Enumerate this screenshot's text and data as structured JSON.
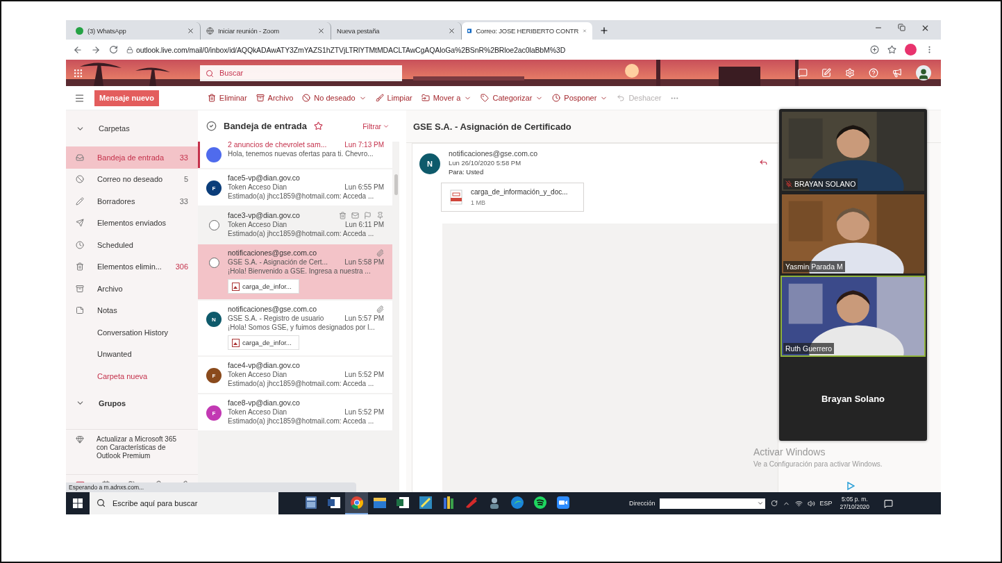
{
  "browser": {
    "tabs": [
      {
        "title": "(3) WhatsApp",
        "selected": false
      },
      {
        "title": "Iniciar reunión - Zoom",
        "selected": false
      },
      {
        "title": "Nueva pestaña",
        "selected": false
      },
      {
        "title": "Correo: JOSE HERIBERTO CONTR",
        "selected": true
      }
    ],
    "url": "outlook.live.com/mail/0/inbox/id/AQQkADAwATY3ZmYAZS1hZTVjLTRlYTMtMDACLTAwCgAQAloGa%2BSnR%2BRloe2ac0laBbM%3D"
  },
  "outlook": {
    "search_placeholder": "Buscar",
    "new_message": "Mensaje nuevo",
    "commands": [
      {
        "label": "Eliminar",
        "menu": false,
        "disabled": false
      },
      {
        "label": "Archivo",
        "menu": false,
        "disabled": false
      },
      {
        "label": "No deseado",
        "menu": true,
        "disabled": false
      },
      {
        "label": "Limpiar",
        "menu": false,
        "disabled": false
      },
      {
        "label": "Mover a",
        "menu": true,
        "disabled": false
      },
      {
        "label": "Categorizar",
        "menu": true,
        "disabled": false
      },
      {
        "label": "Posponer",
        "menu": true,
        "disabled": false
      },
      {
        "label": "Deshacer",
        "menu": false,
        "disabled": true
      }
    ],
    "folders": {
      "title": "Carpetas",
      "expanded": true,
      "items": [
        {
          "kind": "folder",
          "label": "Bandeja de entrada",
          "count": "33",
          "count_highlight": true,
          "selected": true
        },
        {
          "kind": "folder",
          "label": "Correo no deseado",
          "count": "5",
          "count_highlight": false,
          "selected": false
        },
        {
          "kind": "folder",
          "label": "Borradores",
          "count": "33",
          "count_highlight": false,
          "selected": false
        },
        {
          "kind": "folder",
          "label": "Elementos enviados",
          "selected": false
        },
        {
          "kind": "folder",
          "label": "Scheduled",
          "selected": false
        },
        {
          "kind": "folder",
          "label": "Elementos elimin...",
          "count": "306",
          "count_highlight": true,
          "selected": false
        },
        {
          "kind": "folder",
          "label": "Archivo",
          "selected": false
        },
        {
          "kind": "folder",
          "label": "Notas",
          "selected": false
        },
        {
          "kind": "folder",
          "label": "Conversation History",
          "selected": false
        },
        {
          "kind": "folder",
          "label": "Unwanted",
          "selected": false
        },
        {
          "kind": "link",
          "label": "Carpeta nueva",
          "selected": false
        }
      ]
    },
    "groups": {
      "title": "Grupos",
      "expanded": true
    },
    "upgrade": "Actualizar a Microsoft 365 con Características de Outlook Premium",
    "list": {
      "title": "Bandeja de entrada",
      "favorite": false,
      "filter": "Filtrar",
      "messages": [
        {
          "sender": "2 anuncios de chevrolet sam...",
          "time": "Lun 7:13 PM",
          "preview": "Hola, tenemos nuevas ofertas para ti. Chevro...",
          "unread": true,
          "selected": false,
          "hovered": false,
          "color": "#4f6bed",
          "attachment": false
        },
        {
          "sender": "face5-vp@dian.gov.co",
          "subject": "Token Acceso Dian",
          "time": "Lun 6:55 PM",
          "preview": "Estimado(a) jhcc1859@hotmail.com: Acceda ...",
          "unread": false,
          "selected": false,
          "hovered": false,
          "avatar": "F",
          "color": "#0b3d7a",
          "attachment": false
        },
        {
          "sender": "face3-vp@dian.gov.co",
          "subject": "Token Acceso Dian",
          "time": "Lun 6:11 PM",
          "preview": "Estimado(a) jhcc1859@hotmail.com: Acceda ...",
          "unread": false,
          "selected": false,
          "hovered": true,
          "attachment": false
        },
        {
          "sender": "notificaciones@gse.com.co",
          "subject": "GSE S.A. - Asignación de Cert...",
          "time": "Lun 5:58 PM",
          "preview": "¡Hola! Bienvenido a GSE. Ingresa a nuestra ...",
          "unread": false,
          "selected": true,
          "hovered": false,
          "attachment": true,
          "chip": "carga_de_infor..."
        },
        {
          "sender": "notificaciones@gse.com.co",
          "subject": "GSE S.A. - Registro de usuario",
          "time": "Lun 5:57 PM",
          "preview": "¡Hola! Somos GSE, y fuimos designados por l...",
          "unread": false,
          "selected": false,
          "hovered": false,
          "avatar": "N",
          "color": "#0e5a6b",
          "attachment": true,
          "chip": "carga_de_infor..."
        },
        {
          "sender": "face4-vp@dian.gov.co",
          "subject": "Token Acceso Dian",
          "time": "Lun 5:52 PM",
          "preview": "Estimado(a) jhcc1859@hotmail.com: Acceda ...",
          "unread": false,
          "selected": false,
          "hovered": false,
          "avatar": "F",
          "color": "#8a4a1c",
          "attachment": false
        },
        {
          "sender": "face8-vp@dian.gov.co",
          "subject": "Token Acceso Dian",
          "time": "Lun 5:52 PM",
          "preview": "Estimado(a) jhcc1859@hotmail.com: Acceda ...",
          "unread": false,
          "selected": false,
          "hovered": false,
          "avatar": "F",
          "color": "#c239b3",
          "attachment": false
        }
      ]
    },
    "reading": {
      "subject": "GSE S.A. - Asignación de Certificado",
      "avatar": "N",
      "sender": "notificaciones@gse.com.co",
      "date": "Lun 26/10/2020 5:58 PM",
      "to_label": "Para:",
      "to": "Usted",
      "attachment": {
        "name": "carga_de_información_y_doc...",
        "size": "1 MB"
      }
    },
    "status": "Esperando a m.adnxs.com..."
  },
  "zoom": {
    "participants": [
      {
        "name": "BRAYAN SOLANO",
        "kind": "video",
        "muted": true,
        "speaking": false
      },
      {
        "name": "Yasmin Parada M",
        "kind": "video",
        "muted": false,
        "speaking": false
      },
      {
        "name": "Ruth Guerrero",
        "kind": "video",
        "muted": false,
        "speaking": true
      },
      {
        "name": "Brayan Solano",
        "kind": "no_video",
        "muted": false,
        "speaking": false
      }
    ]
  },
  "activation": {
    "title": "Activar Windows",
    "text": "Ve a Configuración para activar Windows."
  },
  "taskbar": {
    "search_placeholder": "Escribe aquí para buscar",
    "apps": [
      {
        "kind": "calculator",
        "active": false
      },
      {
        "kind": "document",
        "active": false
      },
      {
        "kind": "browser",
        "active": true
      },
      {
        "kind": "folder",
        "active": false
      },
      {
        "kind": "spreadsheet",
        "active": false
      },
      {
        "kind": "drawing",
        "active": false
      },
      {
        "kind": "books",
        "active": false
      },
      {
        "kind": "pen",
        "active": false
      },
      {
        "kind": "figure",
        "active": false
      },
      {
        "kind": "globe",
        "active": false
      },
      {
        "kind": "music",
        "active": false
      },
      {
        "kind": "video",
        "active": false
      }
    ],
    "address_label": "Dirección",
    "language": "ESP",
    "time": "5:05 p. m.",
    "date": "27/10/2020"
  }
}
